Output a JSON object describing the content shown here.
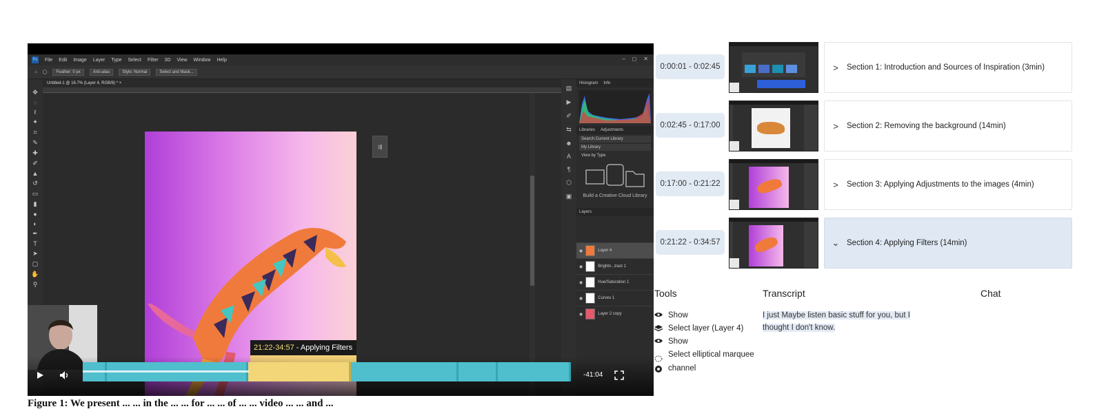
{
  "video": {
    "ps_menu": [
      "File",
      "Edit",
      "Image",
      "Layer",
      "Type",
      "Select",
      "Filter",
      "3D",
      "View",
      "Window",
      "Help"
    ],
    "ps_options": [
      "Feather: 0 px",
      "Anti-alias",
      "Style: Normal",
      "Select and Mask..."
    ],
    "ps_doc_tab": "Untitled-1 @ 16.7% (Layer 4, RGB/8) * ×",
    "ps_panels": {
      "histogram_tabs": [
        "Histogram",
        "Info"
      ],
      "library_tabs": [
        "Libraries",
        "Adjustments"
      ],
      "library_search": "Search Current Library",
      "library_name": "My Library",
      "view_by": "View by Type",
      "library_caption": "Build a Creative Cloud Library",
      "layers_tab": "Layers",
      "layers": [
        "Layer 4",
        "Brightn...trast 1",
        "Hue/Saturation 1",
        "Curves 1",
        "Layer 2 copy"
      ]
    },
    "tooltip": {
      "time": "21:22-34:57",
      "label": " - Applying Filters"
    },
    "remaining": "-41:04",
    "segments": [
      {
        "fraction": 0.05,
        "highlight": false
      },
      {
        "fraction": 0.29,
        "highlight": false
      },
      {
        "fraction": 0.21,
        "highlight": true
      },
      {
        "fraction": 0.22,
        "highlight": false
      },
      {
        "fraction": 0.08,
        "highlight": false
      },
      {
        "fraction": 0.15,
        "highlight": false
      }
    ],
    "progress_fraction": 0.34,
    "colors": {
      "segment": "#4fbfce",
      "segment_active": "#f2d677"
    }
  },
  "sections": [
    {
      "time": "0:00:01 - 0:02:45",
      "title": "Section 1: Introduction and Sources of Inspiration (3min)",
      "expanded": false
    },
    {
      "time": "0:02:45 - 0:17:00",
      "title": "Section 2: Removing the background (14min)",
      "expanded": false
    },
    {
      "time": "0:17:00 - 0:21:22",
      "title": "Section 3: Applying Adjustments to the images (4min)",
      "expanded": false
    },
    {
      "time": "0:21:22 - 0:34:57",
      "title": "Section 4: Applying Filters (14min)",
      "expanded": true
    }
  ],
  "panels": {
    "tools_header": "Tools",
    "transcript_header": "Transcript",
    "chat_header": "Chat"
  },
  "tools": [
    {
      "icon": "eye-icon",
      "label": "Show"
    },
    {
      "icon": "layers-icon",
      "label": "Select layer (Layer 4)"
    },
    {
      "icon": "eye-icon",
      "label": "Show"
    },
    {
      "icon": "elliptical-marquee-icon",
      "label": "Select elliptical marquee"
    },
    {
      "icon": "channel-icon",
      "label": "channel"
    }
  ],
  "transcript": "I just Maybe listen basic stuff for you, but I thought I don't know.",
  "caption": "Figure 1: We present ... ... in the ... ... for ... ... of ... ... video ... ... and ..."
}
